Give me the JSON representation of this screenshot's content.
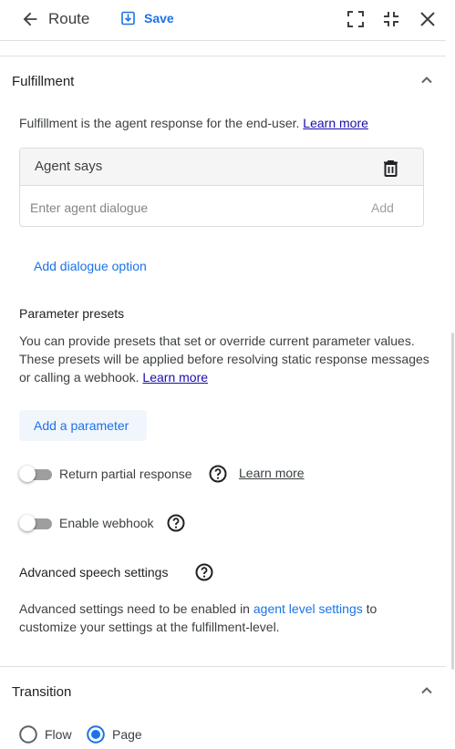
{
  "header": {
    "title": "Route",
    "save_label": "Save",
    "icons": [
      "back-arrow-icon",
      "save-icon",
      "expand-icon",
      "collapse-icon",
      "close-icon"
    ]
  },
  "fulfillment": {
    "title": "Fulfillment",
    "description": "Fulfillment is the agent response for the end-user.",
    "learn_more": "Learn more",
    "agent_says": {
      "label": "Agent says",
      "placeholder": "Enter agent dialogue",
      "add_label": "Add"
    },
    "add_dialogue_option": "Add dialogue option"
  },
  "parameter_presets": {
    "title": "Parameter presets",
    "description": "You can provide presets that set or override current parameter values. These presets will be applied before resolving static response messages or calling a webhook.",
    "learn_more": "Learn more",
    "add_parameter": "Add a parameter"
  },
  "toggles": {
    "partial_response_label": "Return partial response",
    "partial_response_learn_more": "Learn more",
    "partial_response_on": false,
    "webhook_label": "Enable webhook",
    "webhook_on": false
  },
  "advanced_speech": {
    "title": "Advanced speech settings",
    "description_prefix": "Advanced settings need to be enabled in",
    "link": "agent level settings",
    "description_suffix": "to",
    "description_line2": "customize your settings at the fulfillment-level."
  },
  "transition": {
    "title": "Transition",
    "options": [
      {
        "label": "Flow",
        "selected": false
      },
      {
        "label": "Page",
        "selected": true
      }
    ]
  },
  "colors": {
    "accent": "#1a73e8",
    "link": "#1a0dab",
    "toggle_off": "#9e9e9e"
  }
}
